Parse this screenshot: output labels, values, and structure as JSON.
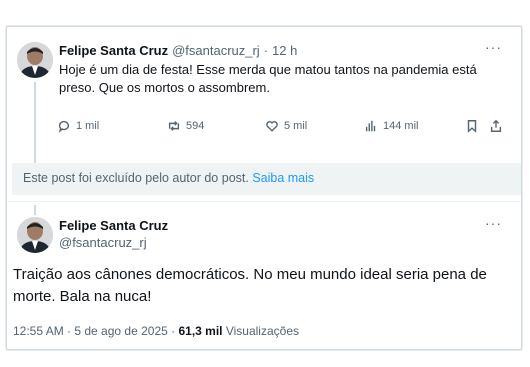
{
  "tweet1": {
    "name": "Felipe Santa Cruz",
    "handle": "@fsantacruz_rj",
    "sep": "·",
    "time": "12 h",
    "line1": "Hoje é um dia de festa! Esse merda que matou tantos na pandemia está",
    "line2": "preso. Que os mortos o assombrem.",
    "more": "···",
    "actions": {
      "replies": "1 mil",
      "retweets": "594",
      "likes": "5 mil",
      "views": "144 mil"
    }
  },
  "deleted_notice": {
    "text": "Este post foi excluído pelo autor do post.",
    "link": "Saiba mais"
  },
  "tweet2": {
    "name": "Felipe Santa Cruz",
    "handle": "@fsantacruz_rj",
    "more": "···",
    "line1": "Traição aos cânones democráticos. No meu mundo ideal seria pena de",
    "line2": "morte. Bala na nuca!",
    "timestamp": "12:55 AM · 5 de ago de 2025 ·",
    "views_count": "61,3 mil",
    "views_label": "Visualizações"
  },
  "colors": {
    "accent": "#1d9bf0",
    "muted": "#536471",
    "notice_bg": "#eff3f4",
    "border": "#cfd9de"
  }
}
